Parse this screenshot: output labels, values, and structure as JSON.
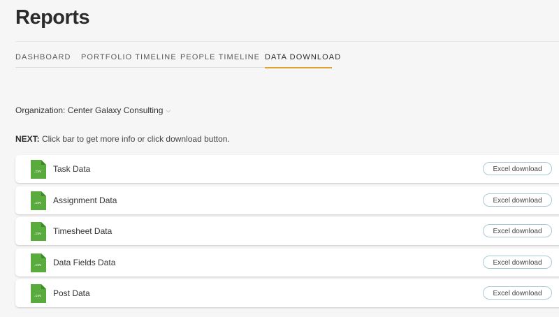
{
  "header": {
    "title": "Reports"
  },
  "tabs": [
    {
      "label": "DASHBOARD",
      "active": false
    },
    {
      "label": "PORTFOLIO TIMELINE",
      "active": false
    },
    {
      "label": "PEOPLE TIMELINE",
      "active": false
    },
    {
      "label": "DATA DOWNLOAD",
      "active": true
    }
  ],
  "organization": {
    "label": "Organization: Center Galaxy Consulting",
    "chevron": "⌵"
  },
  "instruction": {
    "prefix": "NEXT:",
    "text": " Click bar to get more info or click download button."
  },
  "data_rows": [
    {
      "label": "Task Data",
      "icon": "csv-file-icon",
      "icon_text": ".csv",
      "button": "Excel download"
    },
    {
      "label": "Assignment Data",
      "icon": "csv-file-icon",
      "icon_text": ".csv",
      "button": "Excel download"
    },
    {
      "label": "Timesheet Data",
      "icon": "csv-file-icon",
      "icon_text": ".csv",
      "button": "Excel download"
    },
    {
      "label": "Data Fields Data",
      "icon": "csv-file-icon",
      "icon_text": ".csv",
      "button": "Excel download"
    },
    {
      "label": "Post Data",
      "icon": "csv-file-icon",
      "icon_text": ".csv",
      "button": "Excel download"
    }
  ],
  "colors": {
    "accent": "#e0a32e",
    "csv_icon": "#5aab3d",
    "button_border": "#a9c8d6",
    "background": "#f6f6f6"
  }
}
